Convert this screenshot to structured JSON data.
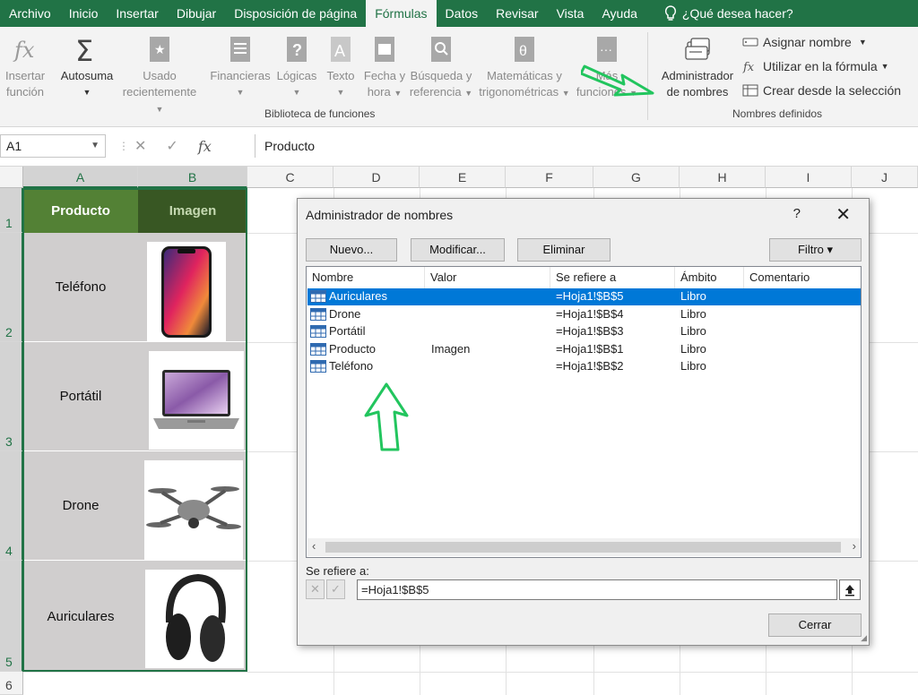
{
  "menu": {
    "tabs": [
      "Archivo",
      "Inicio",
      "Insertar",
      "Dibujar",
      "Disposición de página",
      "Fórmulas",
      "Datos",
      "Revisar",
      "Vista",
      "Ayuda"
    ],
    "active_tab": "Fórmulas",
    "tell_me": "¿Qué desea hacer?"
  },
  "ribbon": {
    "insert_function": [
      "Insertar",
      "función"
    ],
    "autosum": "Autosuma",
    "recent": [
      "Usado",
      "recientemente"
    ],
    "financial": "Financieras",
    "logical": "Lógicas",
    "text": "Texto",
    "datetime": [
      "Fecha y",
      "hora"
    ],
    "lookup": [
      "Búsqueda y",
      "referencia"
    ],
    "math": [
      "Matemáticas y",
      "trigonométricas"
    ],
    "more": [
      "Más",
      "funciones"
    ],
    "library_label": "Biblioteca de funciones",
    "name_manager": [
      "Administrador",
      "de nombres"
    ],
    "define_name": "Asignar nombre",
    "use_in_formula": "Utilizar en la fórmula",
    "create_from_selection": "Crear desde la selección",
    "defined_names_label": "Nombres definidos"
  },
  "formula_bar": {
    "name_box": "A1",
    "content": "Producto"
  },
  "grid": {
    "columns": [
      "A",
      "B",
      "C",
      "D",
      "E",
      "F",
      "G",
      "H",
      "I",
      "J"
    ],
    "rows": [
      "1",
      "2",
      "3",
      "4",
      "5",
      "6"
    ],
    "header_a": "Producto",
    "header_b": "Imagen",
    "products": [
      "Teléfono",
      "Portátil",
      "Drone",
      "Auriculares"
    ]
  },
  "dialog": {
    "title": "Administrador de nombres",
    "help": "?",
    "close": "✕",
    "btn_new": "Nuevo...",
    "btn_edit": "Modificar...",
    "btn_delete": "Eliminar",
    "btn_filter": "Filtro ▾",
    "columns": [
      "Nombre",
      "Valor",
      "Se refiere a",
      "Ámbito",
      "Comentario"
    ],
    "rows": [
      {
        "name": "Auriculares",
        "value": "",
        "ref": "=Hoja1!$B$5",
        "scope": "Libro",
        "comment": ""
      },
      {
        "name": "Drone",
        "value": "",
        "ref": "=Hoja1!$B$4",
        "scope": "Libro",
        "comment": ""
      },
      {
        "name": "Portátil",
        "value": "",
        "ref": "=Hoja1!$B$3",
        "scope": "Libro",
        "comment": ""
      },
      {
        "name": "Producto",
        "value": "Imagen",
        "ref": "=Hoja1!$B$1",
        "scope": "Libro",
        "comment": ""
      },
      {
        "name": "Teléfono",
        "value": "",
        "ref": "=Hoja1!$B$2",
        "scope": "Libro",
        "comment": ""
      }
    ],
    "refers_to_label": "Se refiere a:",
    "refers_to_value": "=Hoja1!$B$5",
    "btn_close": "Cerrar"
  },
  "colors": {
    "excel_green": "#217346",
    "header_a": "#538135",
    "header_b": "#385723",
    "selection_blue": "#0078d7",
    "annotation_arrow": "#22c55e"
  }
}
